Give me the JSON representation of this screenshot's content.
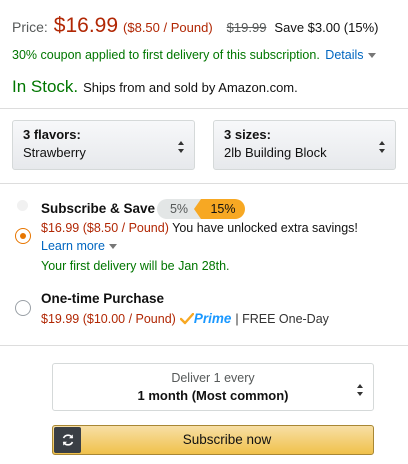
{
  "price": {
    "label": "Price:",
    "amount": "$16.99",
    "unit_price": "($8.50 / Pound)",
    "list_price": "$19.99",
    "savings": "Save $3.00 (15%)"
  },
  "coupon": {
    "text": "30% coupon applied to first delivery of this subscription.",
    "details_label": "Details"
  },
  "availability": {
    "status": "In Stock.",
    "ships_from": "Ships from and sold by Amazon.com."
  },
  "selectors": [
    {
      "label": "3 flavors:",
      "value": "Strawberry"
    },
    {
      "label": "3 sizes:",
      "value": "2lb Building Block"
    }
  ],
  "subscribe_save": {
    "title": "Subscribe & Save",
    "tier_low": "5%",
    "tier_high": "15%",
    "price": "$16.99 ($8.50 / Pound)",
    "unlock_text": "You have unlocked extra savings!",
    "learn_more": "Learn more",
    "first_delivery": "Your first delivery will be Jan 28th.",
    "selected": true
  },
  "one_time": {
    "title": "One-time Purchase",
    "price": "$19.99 ($10.00 / Pound)",
    "prime_label": "Prime",
    "shipping": "| FREE One-Day",
    "selected": false
  },
  "delivery": {
    "label": "Deliver 1 every",
    "value": "1 month (Most common)"
  },
  "subscribe_button": {
    "label": "Subscribe now"
  },
  "colors": {
    "price_red": "#b12704",
    "stock_green": "#007600",
    "link_blue": "#0066c0",
    "radio_orange": "#e77600",
    "prime_blue": "#1a98ff",
    "button_yellow": "#f0c14b"
  },
  "icons": {
    "details_caret": "chevron-down-icon",
    "learn_more_caret": "chevron-down-icon",
    "select_arrows": "up-down-arrows-icon",
    "prime_check": "prime-check-icon",
    "button_icon": "refresh-icon"
  }
}
